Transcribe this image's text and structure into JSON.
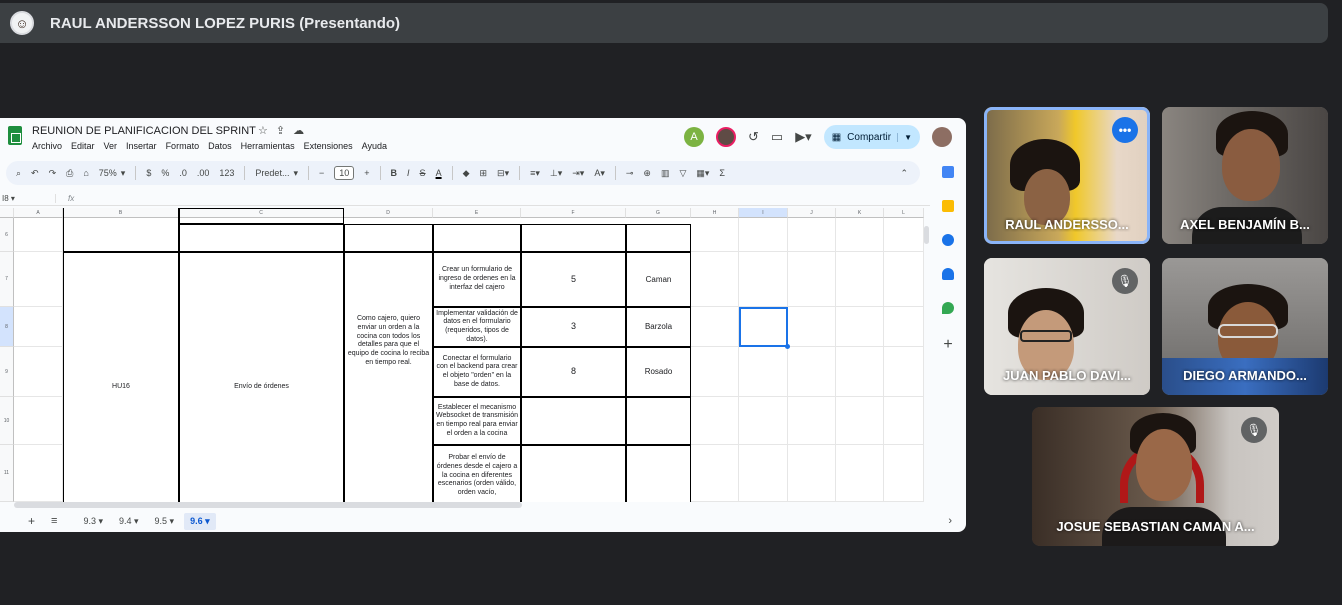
{
  "presenter": {
    "name": "RAUL ANDERSSON LOPEZ PURIS (Presentando)"
  },
  "sheet": {
    "title": "REUNION DE PLANIFICACION DEL SPRINT",
    "menu": [
      "Archivo",
      "Editar",
      "Ver",
      "Insertar",
      "Formato",
      "Datos",
      "Herramientas",
      "Extensiones",
      "Ayuda"
    ],
    "avatar_initial": "A",
    "share_label": "Compartir",
    "toolbar": {
      "zoom": "75%",
      "currency": "$",
      "percent": "%",
      "dec_decrease": ".0",
      "dec_increase": ".00",
      "number_format": "123",
      "font": "Predet...",
      "font_size": "10",
      "bold": "B",
      "italic": "I",
      "strike": "S",
      "text_color": "A",
      "sum": "Σ"
    },
    "namebox": "I8",
    "fx": "fx",
    "columns": [
      "A",
      "B",
      "C",
      "D",
      "E",
      "F",
      "G",
      "H",
      "I",
      "J",
      "K",
      "L"
    ],
    "rows": [
      "6",
      "7",
      "8",
      "9",
      "10",
      "11"
    ],
    "cells": {
      "story_id": "HU16",
      "story_name": "Envío de órdenes",
      "story_desc": "Como cajero, quiero enviar un orden a la cocina con todos los detalles para que el equipo de cocina lo reciba en tiempo real.",
      "tasks": [
        {
          "desc": "Crear un formulario de ingreso de ordenes en la interfaz del cajero",
          "points": "5",
          "owner": "Caman"
        },
        {
          "desc": "Implementar validación de datos en el formulario (requeridos, tipos de datos).",
          "points": "3",
          "owner": "Barzola"
        },
        {
          "desc": "Conectar el formulario con el backend para crear el objeto \"orden\" en la base de datos.",
          "points": "8",
          "owner": "Rosado"
        },
        {
          "desc": "Establecer el mecanismo Websocket de transmisión en tiempo real para enviar el orden a la cocina",
          "points": "",
          "owner": ""
        },
        {
          "desc": "Probar el envío de órdenes desde el cajero a la cocina en diferentes escenarios (orden válido, orden vacío,",
          "points": "",
          "owner": ""
        }
      ]
    },
    "tabs": [
      "9.3",
      "9.4",
      "9.5",
      "9.6"
    ],
    "active_tab": "9.6"
  },
  "participants": [
    {
      "name": "RAUL ANDERSSO...",
      "speaking": true,
      "muted": false
    },
    {
      "name": "AXEL BENJAMÍN B...",
      "speaking": false,
      "muted": false
    },
    {
      "name": "JUAN PABLO DAVI...",
      "speaking": false,
      "muted": true
    },
    {
      "name": "DIEGO ARMANDO...",
      "speaking": false,
      "muted": false
    },
    {
      "name": "JOSUE SEBASTIAN CAMAN A...",
      "speaking": false,
      "muted": true
    }
  ],
  "colors": {
    "background": "#202124",
    "accent": "#1a73e8",
    "sheets_green": "#1e8e3e",
    "share_bg": "#c2e7ff"
  }
}
